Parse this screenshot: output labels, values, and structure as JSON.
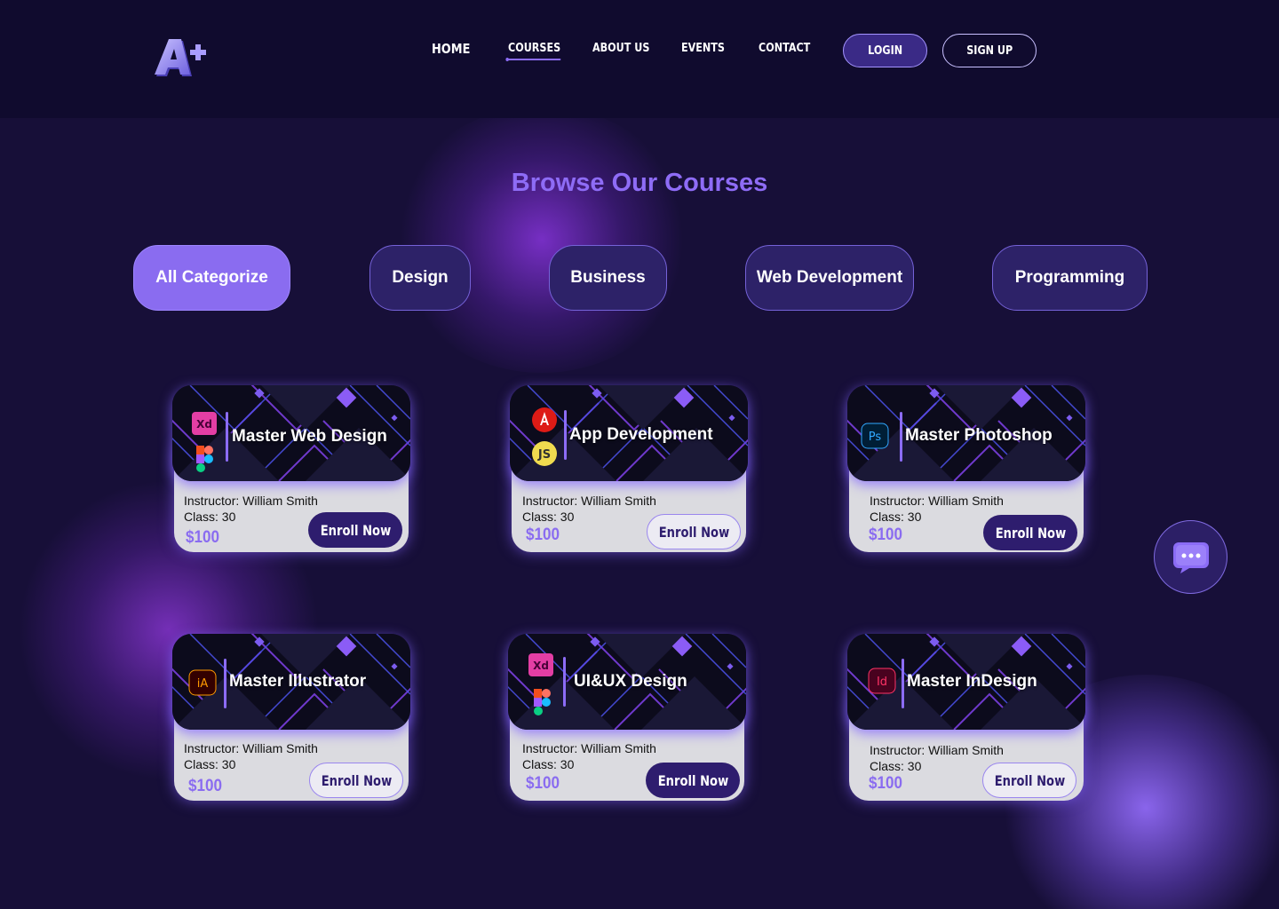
{
  "colors": {
    "background": "#170f38",
    "header": "#100b2e",
    "accent": "#8a6cf0",
    "button_dark": "#2e1d6e",
    "card_body": "#dbdbe0"
  },
  "header": {
    "logo_icon": "a-plus-logo-icon",
    "nav": [
      {
        "label": "HOME"
      },
      {
        "label": "COURSES",
        "active": true
      },
      {
        "label": "ABOUT US"
      },
      {
        "label": "EVENTS"
      },
      {
        "label": "CONTACT"
      }
    ],
    "login_label": "LOGIN",
    "signup_label": "SIGN UP"
  },
  "page_title": "Browse Our Courses",
  "categories": [
    {
      "label": "All Categorize",
      "active": true
    },
    {
      "label": "Design"
    },
    {
      "label": "Business"
    },
    {
      "label": "Web Development"
    },
    {
      "label": "Programming"
    }
  ],
  "courses": [
    {
      "title": "Master Web Design",
      "icons": [
        "adobe-xd-icon",
        "figma-icon"
      ],
      "icon_text": [
        "Xd"
      ],
      "instructor": "Instructor: William Smith",
      "class": "Class: 30",
      "price": "$100",
      "button": "Enroll Now",
      "button_style": "filled"
    },
    {
      "title": "App Development",
      "icons": [
        "angular-icon",
        "javascript-icon"
      ],
      "icon_text": [
        "JS"
      ],
      "instructor": "Instructor: William Smith",
      "class": "Class: 30",
      "price": "$100",
      "button": "Enroll Now",
      "button_style": "outline"
    },
    {
      "title": "Master Photoshop",
      "icons": [
        "photoshop-icon"
      ],
      "icon_text": [
        "Ps"
      ],
      "instructor": "Instructor: William Smith",
      "class": "Class: 30",
      "price": "$100",
      "button": "Enroll Now",
      "button_style": "filled"
    },
    {
      "title": "Master Illustrator",
      "icons": [
        "illustrator-icon"
      ],
      "icon_text": [
        "iA"
      ],
      "instructor": "Instructor: William Smith",
      "class": "Class: 30",
      "price": "$100",
      "button": "Enroll Now",
      "button_style": "outline"
    },
    {
      "title": "UI&UX Design",
      "icons": [
        "adobe-xd-icon",
        "figma-icon"
      ],
      "icon_text": [
        "Xd"
      ],
      "instructor": "Instructor: William Smith",
      "class": "Class: 30",
      "price": "$100",
      "button": "Enroll Now",
      "button_style": "filled"
    },
    {
      "title": "Master InDesign",
      "icons": [
        "indesign-icon"
      ],
      "icon_text": [
        "Id"
      ],
      "instructor": "Instructor: William Smith",
      "class": "Class: 30",
      "price": "$100",
      "button": "Enroll Now",
      "button_style": "outline"
    }
  ],
  "chat_icon": "chat-bubble-icon"
}
